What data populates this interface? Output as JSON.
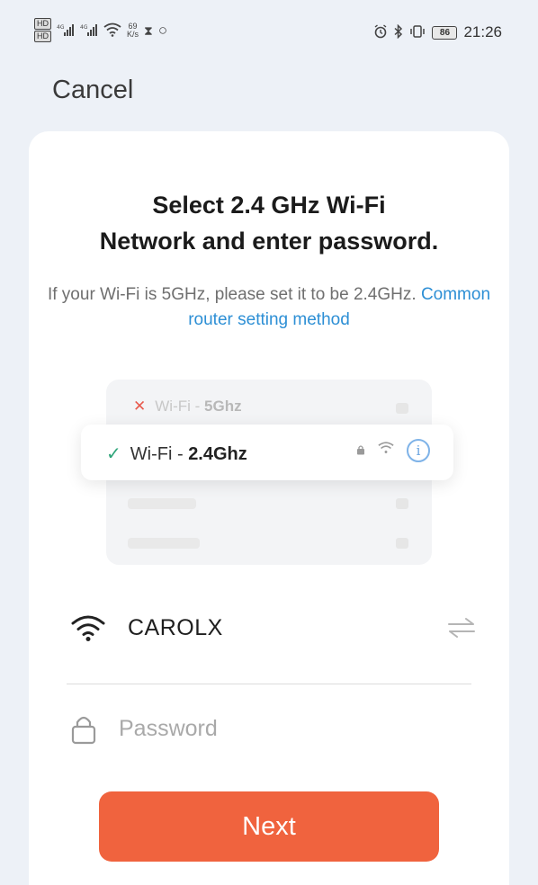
{
  "status_bar": {
    "hd_badge_1": "HD",
    "hd_badge_2": "HD",
    "signal_1": "⁴ᴳ",
    "signal_2": "⁴ᴳ",
    "speed_value": "69",
    "speed_unit": "K/s",
    "battery": "86",
    "time": "21:26"
  },
  "header": {
    "cancel_label": "Cancel"
  },
  "card": {
    "title_line1": "Select 2.4 GHz Wi-Fi",
    "title_line2": "Network and enter password.",
    "subtitle_text": "If your Wi-Fi is 5GHz, please set it to be 2.4GHz.",
    "subtitle_link": "Common router setting method"
  },
  "illustration": {
    "row_5g_prefix": "Wi-Fi - ",
    "row_5g_band": "5Ghz",
    "row_24g_prefix": "Wi-Fi - ",
    "row_24g_band": "2.4Ghz",
    "reject_mark": "✕",
    "accept_mark": "✓",
    "info_mark": "i"
  },
  "form": {
    "ssid": "CAROLX",
    "password_placeholder": "Password",
    "password_value": ""
  },
  "actions": {
    "next_label": "Next"
  },
  "colors": {
    "accent": "#f0633e",
    "link": "#2d8fd5",
    "success": "#2fa57a",
    "error": "#e85b4e",
    "background": "#edf1f7"
  },
  "icons": {
    "wifi": "wifi-icon",
    "lock": "lock-icon",
    "switch": "swap-arrows-icon",
    "info": "info-circle-icon"
  }
}
